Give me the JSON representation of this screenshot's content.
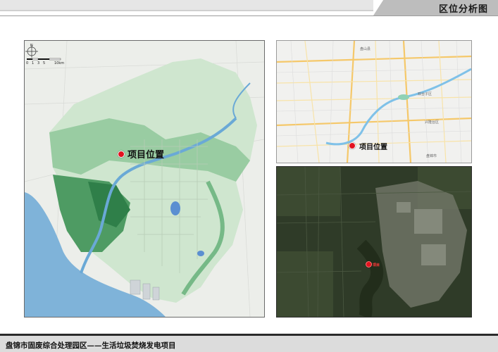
{
  "header": {
    "title": "区位分析图"
  },
  "left_map": {
    "marker_label": "项目位置",
    "scale_ticks": [
      "0",
      "1",
      "3",
      "5",
      "10km"
    ],
    "north_letter": "N"
  },
  "road_map": {
    "marker_label": "项目位置",
    "place_labels": [
      "盘山县",
      "双台子区",
      "兴隆台区",
      "盘锦市"
    ]
  },
  "satellite_map": {
    "marker_label": "项目"
  },
  "footer": {
    "project_title": "盘锦市固废综合处理园区——生活垃圾焚烧发电项目"
  },
  "colors": {
    "marker": "#e3121f",
    "water": "#7fb3d9",
    "zone_light": "#cfe6cf",
    "zone_dark": "#4e9b63"
  }
}
